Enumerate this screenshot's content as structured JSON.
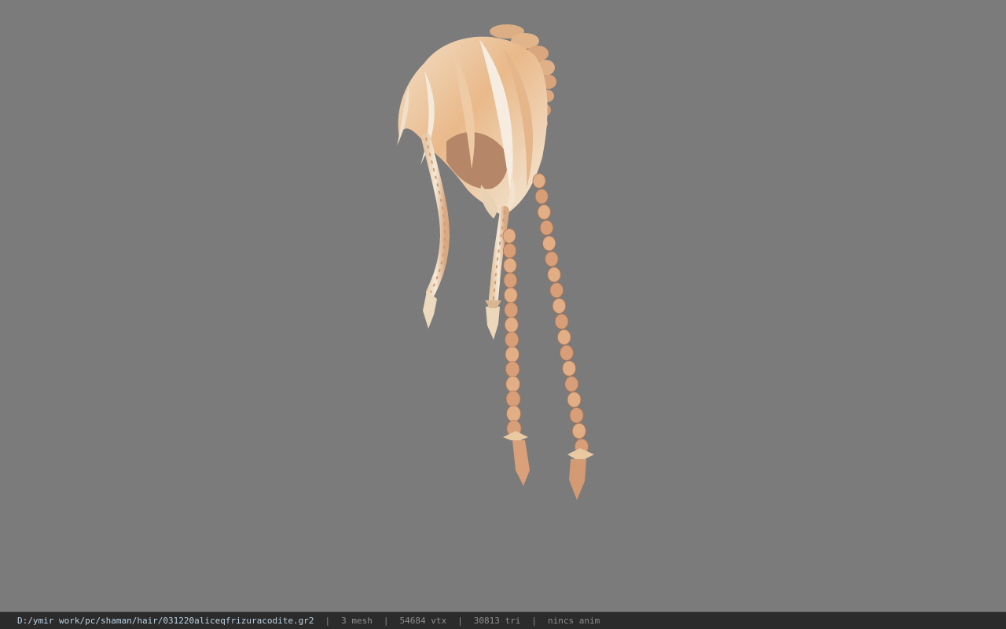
{
  "viewer": {
    "background_color": "#7b7b7b",
    "model_description": "hair",
    "hair_colors": [
      "#f3e6d2",
      "#e8b585",
      "#d89a70",
      "#b9825e"
    ]
  },
  "status_bar": {
    "file_path": "D:/ymir work/pc/shaman/hair/031220aliceqfrizuracodite.gr2",
    "separator": "|",
    "mesh_count": "3 mesh",
    "vertex_count": "54684 vtx",
    "triangle_count": "30813 tri",
    "animation": "nincs anim"
  }
}
